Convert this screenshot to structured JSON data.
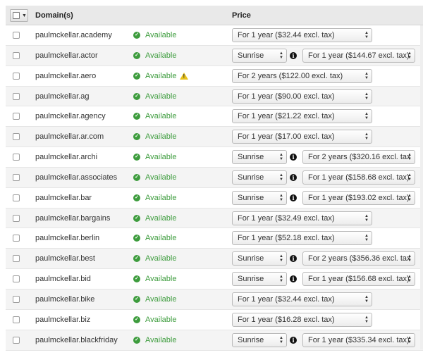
{
  "header": {
    "domain_label": "Domain(s)",
    "price_label": "Price"
  },
  "rows": [
    {
      "domain": "paulmckellar.academy",
      "status": "Available",
      "warning": false,
      "phase": null,
      "period": "For 1 year ($32.44 excl. tax)"
    },
    {
      "domain": "paulmckellar.actor",
      "status": "Available",
      "warning": false,
      "phase": "Sunrise",
      "period": "For 1 year ($144.67 excl. tax)"
    },
    {
      "domain": "paulmckellar.aero",
      "status": "Available",
      "warning": true,
      "phase": null,
      "period": "For 2 years ($122.00 excl. tax)"
    },
    {
      "domain": "paulmckellar.ag",
      "status": "Available",
      "warning": false,
      "phase": null,
      "period": "For 1 year ($90.00 excl. tax)"
    },
    {
      "domain": "paulmckellar.agency",
      "status": "Available",
      "warning": false,
      "phase": null,
      "period": "For 1 year ($21.22 excl. tax)"
    },
    {
      "domain": "paulmckellar.ar.com",
      "status": "Available",
      "warning": false,
      "phase": null,
      "period": "For 1 year ($17.00 excl. tax)"
    },
    {
      "domain": "paulmckellar.archi",
      "status": "Available",
      "warning": false,
      "phase": "Sunrise",
      "period": "For 2 years ($320.16 excl. tax"
    },
    {
      "domain": "paulmckellar.associates",
      "status": "Available",
      "warning": false,
      "phase": "Sunrise",
      "period": "For 1 year ($158.68 excl. tax)"
    },
    {
      "domain": "paulmckellar.bar",
      "status": "Available",
      "warning": false,
      "phase": "Sunrise",
      "period": "For 1 year ($193.02 excl. tax)"
    },
    {
      "domain": "paulmckellar.bargains",
      "status": "Available",
      "warning": false,
      "phase": null,
      "period": "For 1 year ($32.49 excl. tax)"
    },
    {
      "domain": "paulmckellar.berlin",
      "status": "Available",
      "warning": false,
      "phase": null,
      "period": "For 1 year ($52.18 excl. tax)"
    },
    {
      "domain": "paulmckellar.best",
      "status": "Available",
      "warning": false,
      "phase": "Sunrise",
      "period": "For 2 years ($356.36 excl. tax"
    },
    {
      "domain": "paulmckellar.bid",
      "status": "Available",
      "warning": false,
      "phase": "Sunrise",
      "period": "For 1 year ($156.68 excl. tax)"
    },
    {
      "domain": "paulmckellar.bike",
      "status": "Available",
      "warning": false,
      "phase": null,
      "period": "For 1 year ($32.44 excl. tax)"
    },
    {
      "domain": "paulmckellar.biz",
      "status": "Available",
      "warning": false,
      "phase": null,
      "period": "For 1 year ($16.28 excl. tax)"
    },
    {
      "domain": "paulmckellar.blackfriday",
      "status": "Available",
      "warning": false,
      "phase": "Sunrise",
      "period": "For 1 year ($335.34 excl. tax)"
    }
  ]
}
